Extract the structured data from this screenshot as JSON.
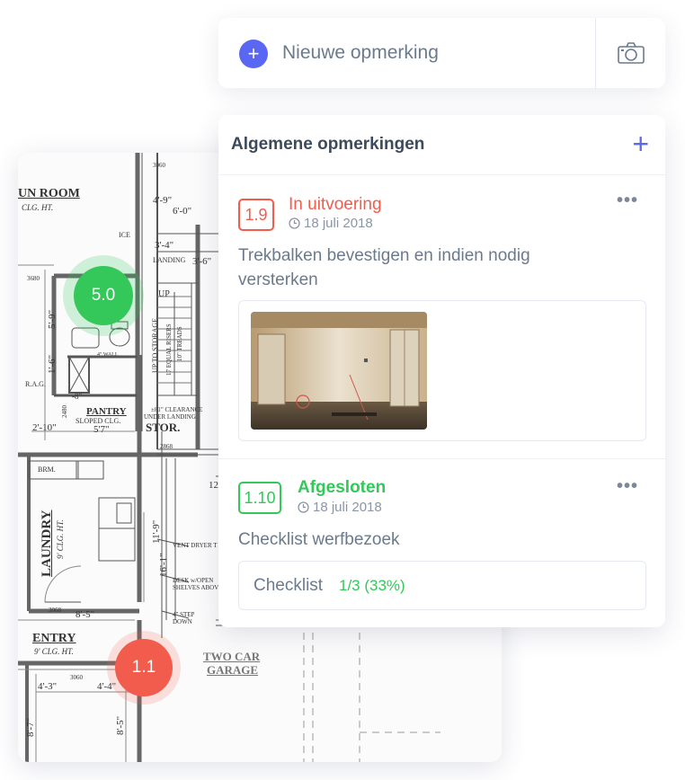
{
  "new_remark": {
    "label": "Nieuwe opmerking",
    "plus_icon": "plus-icon",
    "camera_icon": "camera-icon",
    "accent_color": "#5a67f2"
  },
  "panel": {
    "title": "Algemene opmerkingen",
    "add_icon": "plus-icon",
    "items": [
      {
        "id": "1.9",
        "status": "In uitvoering",
        "status_color": "#f25c4d",
        "date": "18 juli 2018",
        "description": "Trekbalken bevestigen en indien nodig versterken",
        "attachment": "photo",
        "more_icon": "more-icon"
      },
      {
        "id": "1.10",
        "status": "Afgesloten",
        "status_color": "#34c759",
        "date": "18 juli 2018",
        "description": "Checklist werfbezoek",
        "checklist_label": "Checklist",
        "checklist_value": "1/3 (33%)",
        "more_icon": "more-icon"
      }
    ]
  },
  "floor_plan": {
    "markers": [
      {
        "label": "5.0",
        "color": "#34c759"
      },
      {
        "label": "1.1",
        "color": "#f25c4d"
      }
    ],
    "labels": {
      "sun_room": "UN ROOM",
      "sun_room_sub": "CLG. HT.",
      "pantry": "PANTRY",
      "pantry_sub": "SLOPED CLG.",
      "pantry_dim": "5'7\"",
      "stor": "STOR.",
      "laundry": "LAUNDRY",
      "laundry_sub": "9' CLG. HT.",
      "entry": "ENTRY",
      "entry_sub": "9' CLG. HT.",
      "garage": "TWO CAR",
      "garage_2": "GARAGE",
      "ice": "ICE",
      "landing": "LANDING",
      "up": "UP",
      "up_to_storage": "UP TO STORAGE",
      "risers": "17 EQUAL RISERS",
      "treads": "10\" TREADS",
      "clearance": "±81\" CLEARANCE",
      "clearance_2": "UNDER LANDING",
      "brm": "BRM.",
      "rag": "R.A.G.",
      "vent_dryer": "VENT DRYER T",
      "desk": "DESK w/OPEN",
      "desk_2": "SHELVES ABOVE",
      "step": "4\" STEP",
      "step_2": "DOWN",
      "wall": "4\" WALL",
      "d_4_9": "4'-9\"",
      "d_6_0": "6'-0\"",
      "d_3_4": "3'-4\"",
      "d_3_6": "3'-6\"",
      "d_5_9": "5'-9\"",
      "d_1_6": "1'-6\"",
      "d_8": "-8\"",
      "d_2_10": "2'-10\"",
      "d_11_9": "11'-9\"",
      "d_16_1": "16'-1\"",
      "d_8_5": "8'-5\"",
      "d_8_5b": "8'-5\"",
      "d_4_3": "4'-3\"",
      "d_4_4": "4'-4\"",
      "d_8_7": "8'-7\"",
      "d_12": "12",
      "n_3680": "3680",
      "n_3060": "3060",
      "n_3060b": "3060",
      "n_2868": "2868",
      "n_2480": "2480",
      "n_3068": "3068"
    }
  }
}
